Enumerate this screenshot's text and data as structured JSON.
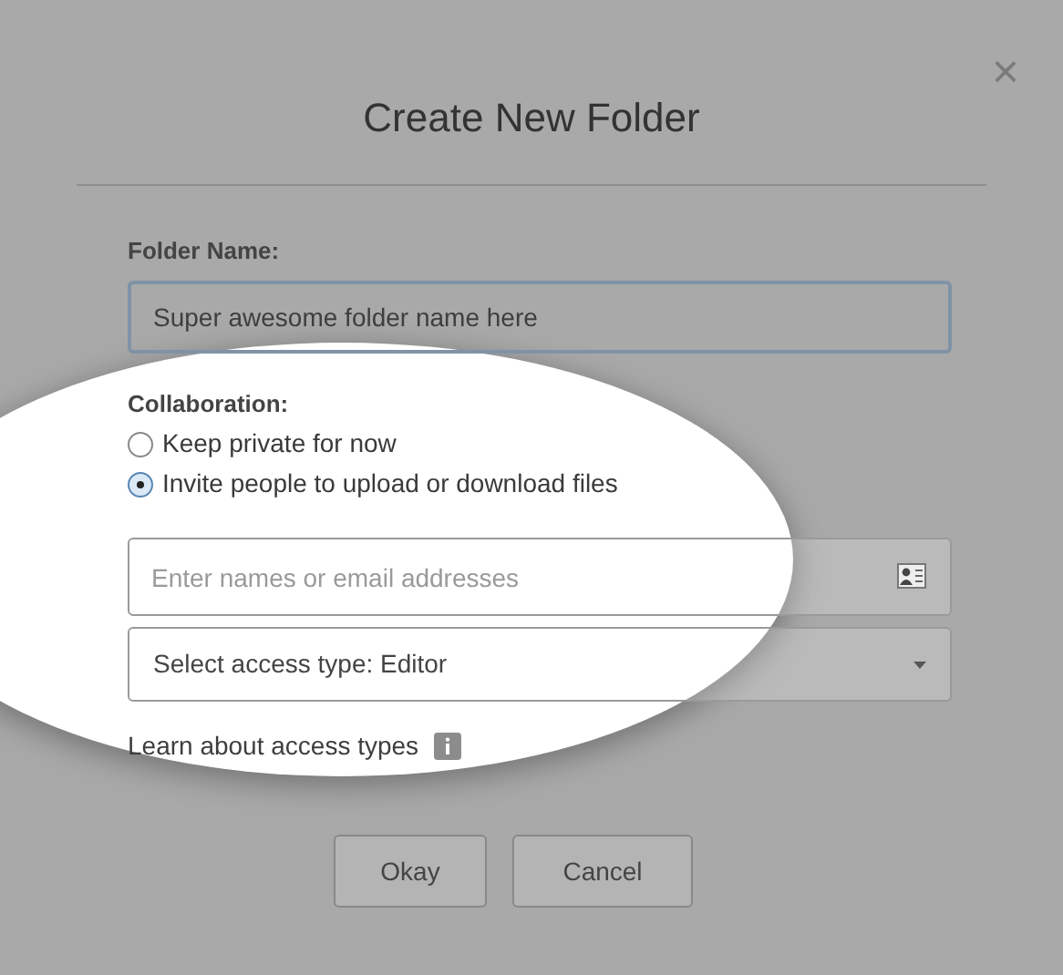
{
  "dialog": {
    "title": "Create New Folder",
    "close": "×"
  },
  "folder_name": {
    "label": "Folder Name:",
    "value": "Super awesome folder name here"
  },
  "collaboration": {
    "label": "Collaboration:",
    "options": [
      {
        "label": "Keep private for now",
        "selected": false
      },
      {
        "label": "Invite people to upload or download files",
        "selected": true
      }
    ]
  },
  "invite": {
    "placeholder": "Enter names or email addresses"
  },
  "access": {
    "value": "Select access type: Editor"
  },
  "learn_link": "Learn about access types",
  "buttons": [
    "Okay",
    "Cancel"
  ]
}
